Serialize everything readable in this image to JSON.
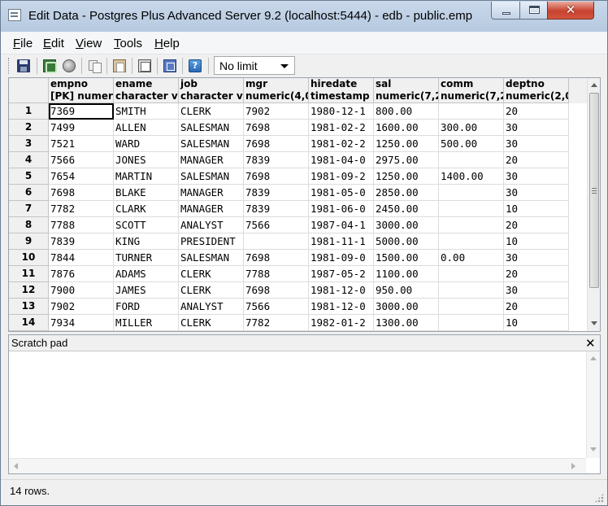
{
  "window": {
    "title": "Edit Data - Postgres Plus Advanced Server 9.2 (localhost:5444) - edb - public.emp",
    "close_glyph": "✕"
  },
  "menu": {
    "items": [
      "File",
      "Edit",
      "View",
      "Tools",
      "Help"
    ]
  },
  "toolbar": {
    "limit_value": "No limit",
    "help_glyph": "?"
  },
  "grid": {
    "columns": [
      {
        "name": "empno",
        "type": "[PK] numeri"
      },
      {
        "name": "ename",
        "type": "character v"
      },
      {
        "name": "job",
        "type": "character v"
      },
      {
        "name": "mgr",
        "type": "numeric(4,0"
      },
      {
        "name": "hiredate",
        "type": "timestamp v"
      },
      {
        "name": "sal",
        "type": "numeric(7,2"
      },
      {
        "name": "comm",
        "type": "numeric(7,2"
      },
      {
        "name": "deptno",
        "type": "numeric(2,0"
      }
    ],
    "rows": [
      {
        "num": "1",
        "cells": [
          "7369",
          "SMITH",
          "CLERK",
          "7902",
          "1980-12-1",
          "800.00",
          "",
          "20"
        ]
      },
      {
        "num": "2",
        "cells": [
          "7499",
          "ALLEN",
          "SALESMAN",
          "7698",
          "1981-02-2",
          "1600.00",
          "300.00",
          "30"
        ]
      },
      {
        "num": "3",
        "cells": [
          "7521",
          "WARD",
          "SALESMAN",
          "7698",
          "1981-02-2",
          "1250.00",
          "500.00",
          "30"
        ]
      },
      {
        "num": "4",
        "cells": [
          "7566",
          "JONES",
          "MANAGER",
          "7839",
          "1981-04-0",
          "2975.00",
          "",
          "20"
        ]
      },
      {
        "num": "5",
        "cells": [
          "7654",
          "MARTIN",
          "SALESMAN",
          "7698",
          "1981-09-2",
          "1250.00",
          "1400.00",
          "30"
        ]
      },
      {
        "num": "6",
        "cells": [
          "7698",
          "BLAKE",
          "MANAGER",
          "7839",
          "1981-05-0",
          "2850.00",
          "",
          "30"
        ]
      },
      {
        "num": "7",
        "cells": [
          "7782",
          "CLARK",
          "MANAGER",
          "7839",
          "1981-06-0",
          "2450.00",
          "",
          "10"
        ]
      },
      {
        "num": "8",
        "cells": [
          "7788",
          "SCOTT",
          "ANALYST",
          "7566",
          "1987-04-1",
          "3000.00",
          "",
          "20"
        ]
      },
      {
        "num": "9",
        "cells": [
          "7839",
          "KING",
          "PRESIDENT",
          "",
          "1981-11-1",
          "5000.00",
          "",
          "10"
        ]
      },
      {
        "num": "10",
        "cells": [
          "7844",
          "TURNER",
          "SALESMAN",
          "7698",
          "1981-09-0",
          "1500.00",
          "0.00",
          "30"
        ]
      },
      {
        "num": "11",
        "cells": [
          "7876",
          "ADAMS",
          "CLERK",
          "7788",
          "1987-05-2",
          "1100.00",
          "",
          "20"
        ]
      },
      {
        "num": "12",
        "cells": [
          "7900",
          "JAMES",
          "CLERK",
          "7698",
          "1981-12-0",
          "950.00",
          "",
          "30"
        ]
      },
      {
        "num": "13",
        "cells": [
          "7902",
          "FORD",
          "ANALYST",
          "7566",
          "1981-12-0",
          "3000.00",
          "",
          "20"
        ]
      },
      {
        "num": "14",
        "cells": [
          "7934",
          "MILLER",
          "CLERK",
          "7782",
          "1982-01-2",
          "1300.00",
          "",
          "10"
        ]
      }
    ]
  },
  "scratch_pad": {
    "title": "Scratch pad",
    "close_glyph": "✕",
    "content": ""
  },
  "status": {
    "text": "14 rows."
  }
}
